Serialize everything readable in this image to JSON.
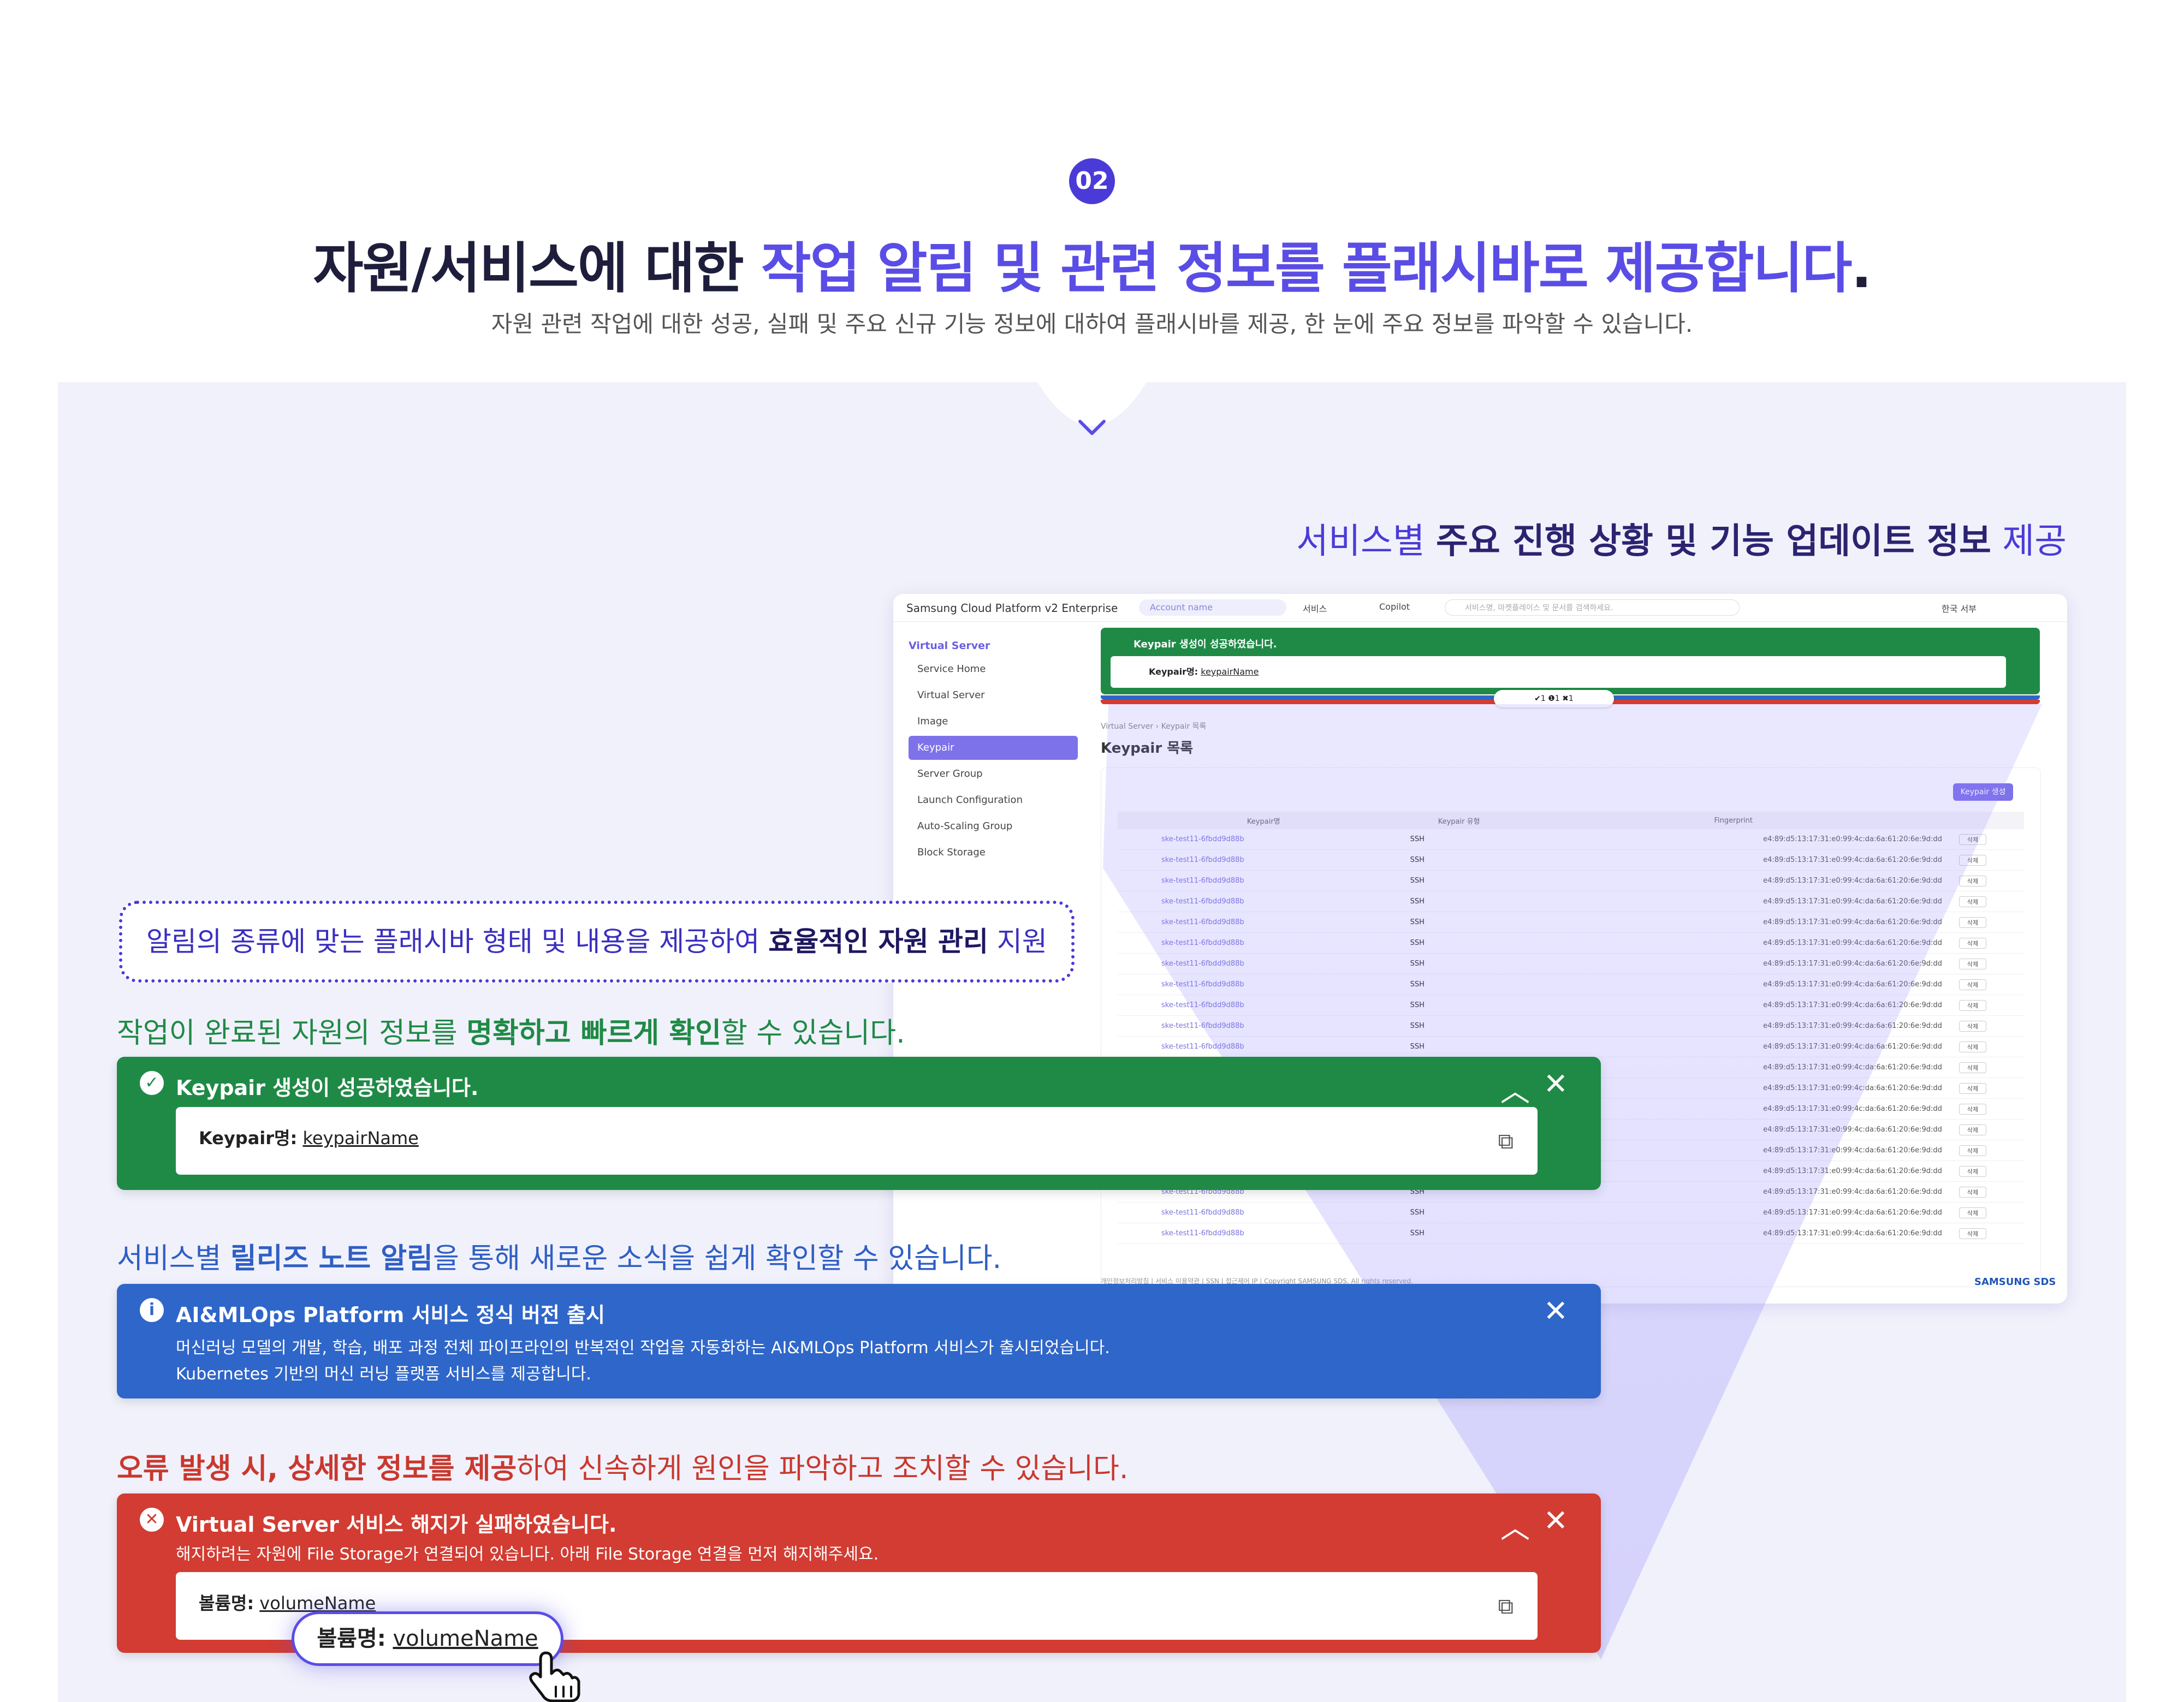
{
  "section": {
    "badge": "02",
    "headline_plain": "자원/서비스에 대한 ",
    "headline_highlight": "작업 알림 및 관련 정보를 플래시바로 제공합니다",
    "headline_end": ".",
    "subline": "자원 관련 작업에 대한 성공, 실패 및 주요 신규 기능 정보에 대하여 플래시바를 제공, 한 눈에 주요 정보를 파악할 수 있습니다."
  },
  "right_caption": {
    "pre": "서비스별 ",
    "bold": "주요 진행 상황 및 기능 업데이트 정보",
    "post": " 제공"
  },
  "dotted_box": {
    "pre": "알림의 종류에 맞는 플래시바 형태 및 내용을 제공하여 ",
    "bold": "효율적인 자원 관리",
    "post": " 지원"
  },
  "captions": {
    "success": {
      "pre": "작업이 완료된 자원의 정보를 ",
      "bold": "명확하고 빠르게 확인",
      "post": "할 수 있습니다."
    },
    "release": {
      "pre": "서비스별 ",
      "bold": "릴리즈 노트 알림",
      "post": "을 통해 새로운 소식을 쉽게 확인할 수 있습니다."
    },
    "error": {
      "bold": "오류 발생 시, 상세한 정보를 제공",
      "post": "하여 신속하게 원인을 파악하고 조치할 수 있습니다."
    }
  },
  "flash_success": {
    "title": "Keypair 생성이 성공하였습니다.",
    "label": "Keypair명:",
    "value": "keypairName",
    "color": "#1f8a46"
  },
  "flash_release": {
    "title": "AI&MLOps Platform 서비스 정식 버전 출시",
    "line1": "머신러닝 모델의 개발, 학습, 배포 과정 전체 파이프라인의 반복적인 작업을 자동화하는 AI&MLOps Platform 서비스가 출시되었습니다.",
    "line2": "Kubernetes 기반의 머신 러닝 플랫폼 서비스를 제공합니다.",
    "color": "#2f66c9"
  },
  "flash_error": {
    "title": "Virtual Server 서비스 해지가 실패하였습니다.",
    "body": "해지하려는 자원에 File Storage가 연결되어 있습니다. 아래 File Storage 연결을 먼저 해지해주세요.",
    "label": "볼륨명:",
    "value": "volumeName",
    "color": "#d23c32"
  },
  "tooltip": {
    "label": "볼륨명:",
    "value": "volumeName"
  },
  "mock": {
    "logo": "Samsung Cloud Platform v2 Enterprise",
    "account": "Account name",
    "services": "서비스",
    "copilot": "Copilot",
    "search_placeholder": "서비스명, 마켓플레이스 및 문서를 검색하세요.",
    "lang": "한국 서부",
    "sidebar_title": "Virtual Server",
    "sidebar_items": [
      "Service Home",
      "Virtual Server",
      "Image",
      "Keypair",
      "Server Group",
      "Launch Configuration",
      "Auto-Scaling Group",
      "Block Storage"
    ],
    "flash_title": "Keypair 생성이 성공하였습니다.",
    "flash_label": "Keypair명:",
    "flash_value": "keypairName",
    "counter": "✔1  ❶1  ✖1",
    "breadcrumb": "Virtual Server  ›  Keypair 목록",
    "page_title": "Keypair 목록",
    "create_button": "Keypair 생성",
    "columns": [
      "Keypair명",
      "Keypair 유형",
      "Fingerprint",
      ""
    ],
    "row_name": "ske-test11-6fbdd9d88b",
    "row_type": "SSH",
    "row_fp": "e4:89:d5:13:17:31:e0:99:4c:da:6a:61:20:6e:9d:dd",
    "row_action": "삭제",
    "row_count": 20,
    "footer": "개인정보처리방침  |  서비스 이용약관  |  SSN  |  접근제어 IP  |  Copyright SAMSUNG SDS. All rights reserved.",
    "brand": "SAMSUNG SDS"
  },
  "colors": {
    "accent": "#5a4de6",
    "success": "#1f8a46",
    "info": "#2f66c9",
    "error": "#d23c32"
  },
  "icons": [
    "check-circle-icon",
    "info-circle-icon",
    "x-circle-icon",
    "chevron-up-icon",
    "close-icon",
    "copy-icon",
    "hand-pointer-icon",
    "chevron-down-icon"
  ]
}
